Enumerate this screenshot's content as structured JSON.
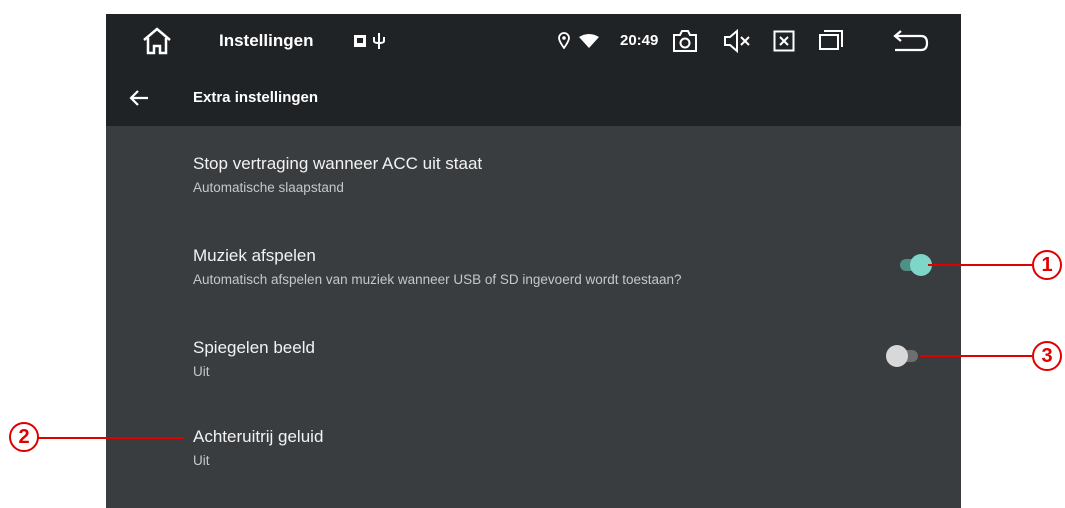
{
  "status_bar": {
    "app_title": "Instellingen",
    "time": "20:49",
    "icons": [
      "home-icon",
      "notification-icon",
      "usb-icon",
      "location-icon",
      "wifi-icon",
      "camera-icon",
      "mute-icon",
      "close-box-icon",
      "recent-apps-icon",
      "back-icon"
    ]
  },
  "app_bar": {
    "title": "Extra instellingen",
    "back_icon": "arrow-left-icon"
  },
  "settings": [
    {
      "title": "Stop vertraging wanneer ACC uit staat",
      "subtitle": "Automatische slaapstand"
    },
    {
      "title": "Muziek afspelen",
      "subtitle": "Automatisch afspelen van muziek wanneer USB of SD ingevoerd wordt toestaan?",
      "toggle_on": true
    },
    {
      "title": "Spiegelen beeld",
      "subtitle": "Uit",
      "toggle_on": false
    },
    {
      "title": "Achteruitrij geluid",
      "subtitle": "Uit"
    }
  ],
  "callouts": [
    "1",
    "2",
    "3"
  ],
  "colors": {
    "background": "#3a3d40",
    "bar": "#202326",
    "toggle_on_thumb": "#7ed6c8",
    "toggle_on_track": "#4e8f86",
    "toggle_off_thumb": "#d8d8d8",
    "toggle_off_track": "#6d6f71",
    "callout": "#e00000"
  }
}
